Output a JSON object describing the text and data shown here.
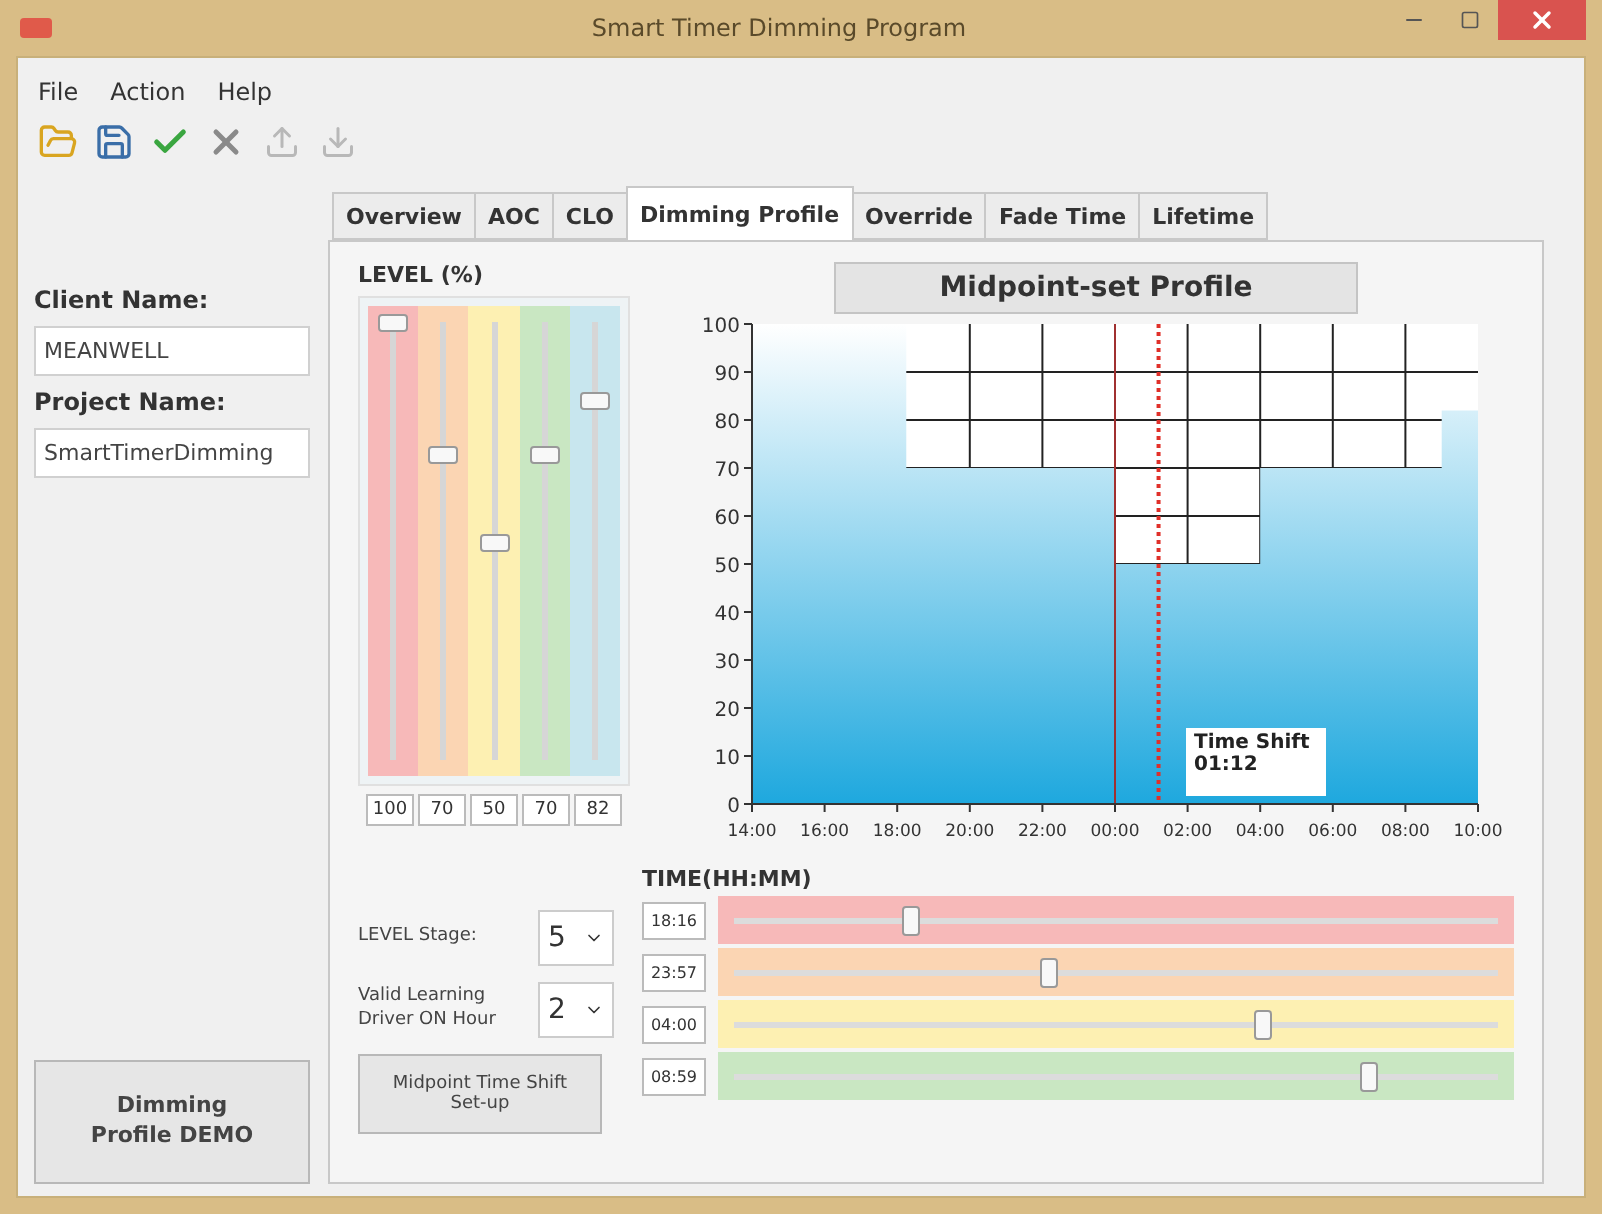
{
  "window": {
    "title": "Smart Timer Dimming Program"
  },
  "menu": [
    "File",
    "Action",
    "Help"
  ],
  "toolbar": [
    {
      "kind": "open",
      "disabled": false
    },
    {
      "kind": "save",
      "disabled": false
    },
    {
      "kind": "apply",
      "disabled": false
    },
    {
      "kind": "cancel",
      "disabled": false
    },
    {
      "kind": "upload",
      "disabled": true
    },
    {
      "kind": "download",
      "disabled": true
    }
  ],
  "sidebar": {
    "client_label": "Client Name:",
    "client_value": "MEANWELL",
    "project_label": "Project Name:",
    "project_value": "SmartTimerDimming",
    "demo_button": "Dimming Profile DEMO"
  },
  "tabs": [
    {
      "label": "Overview",
      "selected": false
    },
    {
      "label": "AOC",
      "selected": false
    },
    {
      "label": "CLO",
      "selected": false
    },
    {
      "label": "Dimming Profile",
      "selected": true
    },
    {
      "label": "Override",
      "selected": false
    },
    {
      "label": "Fade Time",
      "selected": false
    },
    {
      "label": "Lifetime",
      "selected": false
    }
  ],
  "level_panel": {
    "title": "LEVEL (%)",
    "sliders": [
      {
        "level": 1,
        "reading": "100",
        "color": "#f7b9b9"
      },
      {
        "level": 0.7,
        "reading": "70",
        "color": "#fbd5b3"
      },
      {
        "level": 0.5,
        "reading": "50",
        "color": "#fdf0b2"
      },
      {
        "level": 0.7,
        "reading": "70",
        "color": "#c9e7c2"
      },
      {
        "level": 0.82,
        "reading": "82",
        "color": "#c8e6ee"
      }
    ]
  },
  "stage": {
    "label": "LEVEL Stage:",
    "value": "5"
  },
  "learning": {
    "label": "Valid Learning Driver ON Hour",
    "value": "2"
  },
  "shift_button": "Midpoint Time Shift Set-up",
  "profile": {
    "title": "Midpoint-set Profile",
    "time_shift_label": "Time Shift",
    "time_shift_value": "01:12",
    "chart_data": {
      "type": "area",
      "grid": true,
      "categories": [
        "14:00",
        null,
        null,
        null,
        null,
        null,
        null,
        null,
        "16:00",
        null,
        null,
        null,
        null,
        null,
        null,
        null,
        "18:00",
        null,
        null,
        null,
        null,
        null,
        null,
        null,
        "20:00",
        null,
        null,
        null,
        null,
        null,
        null,
        null,
        "22:00",
        null,
        null,
        null,
        null,
        null,
        null,
        null,
        "00:00",
        null,
        null,
        null,
        null,
        null,
        null,
        null,
        "02:00",
        null,
        null,
        null,
        null,
        null,
        null,
        null,
        "04:00",
        null,
        null,
        null,
        null,
        null,
        null,
        null,
        "06:00",
        null,
        null,
        null,
        null,
        null,
        null,
        null,
        "08:00",
        null,
        null,
        null,
        null,
        null,
        null,
        null,
        "10:00"
      ],
      "series": [
        {
          "color": "#1ea8de",
          "values": [
            100,
            100,
            100,
            100,
            100,
            100,
            100,
            100,
            100,
            100,
            100,
            100,
            100,
            100,
            100,
            100,
            100,
            70,
            70,
            70,
            70,
            70,
            70,
            70,
            70,
            70,
            70,
            70,
            70,
            70,
            70,
            70,
            70,
            70,
            70,
            70,
            70,
            70,
            70,
            70,
            50,
            50,
            50,
            50,
            50,
            50,
            50,
            50,
            50,
            50,
            50,
            50,
            50,
            50,
            50,
            50,
            70,
            70,
            70,
            70,
            70,
            70,
            70,
            70,
            70,
            70,
            70,
            70,
            70,
            70,
            70,
            70,
            70,
            70,
            70,
            70,
            82,
            82,
            82,
            82,
            82
          ]
        }
      ],
      "ylim": [
        0,
        100
      ],
      "yticks": [
        0,
        10,
        20,
        30,
        40,
        50,
        60,
        70,
        80,
        90,
        100
      ],
      "ref_lines": [
        {
          "axis": "x",
          "value": "00:00"
        }
      ]
    }
  },
  "time_panel": {
    "title": "TIME(HH:MM)",
    "sliders": [
      {
        "level": 0.23,
        "reading": "18:16",
        "color": "#f7b9b9"
      },
      {
        "level": 0.41,
        "reading": "23:57",
        "color": "#fbd5b3"
      },
      {
        "level": 0.69,
        "reading": "04:00",
        "color": "#fdf0b2"
      },
      {
        "level": 0.83,
        "reading": "08:59",
        "color": "#c9e7c2"
      }
    ]
  }
}
